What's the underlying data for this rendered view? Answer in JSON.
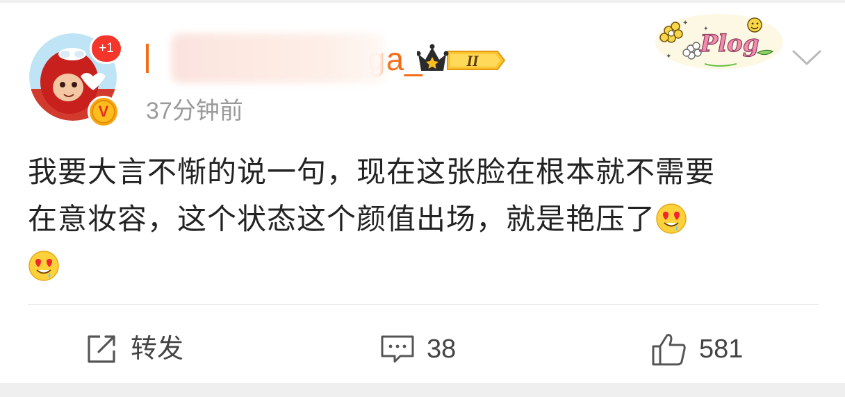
{
  "post": {
    "badge_count": "+1",
    "verified_letter": "V",
    "username_visible": "ga_",
    "vip_level": "II",
    "timestamp": "37分钟前",
    "sticker_text": "Plog",
    "content_line1": "我要大言不惭的说一句，现在这张脸在根本就不需要",
    "content_line2": "在意妆容，这个状态这个颜值出场，就是艳压了",
    "emoji_icon": "heart-eyes-emoji"
  },
  "actions": {
    "repost_label": "转发",
    "comment_count": "38",
    "like_count": "581"
  },
  "colors": {
    "username": "#f36d17",
    "badge_red": "#f4352b",
    "verified_gold": "#fcbd1f",
    "text": "#232323",
    "meta": "#9a9a9a"
  }
}
